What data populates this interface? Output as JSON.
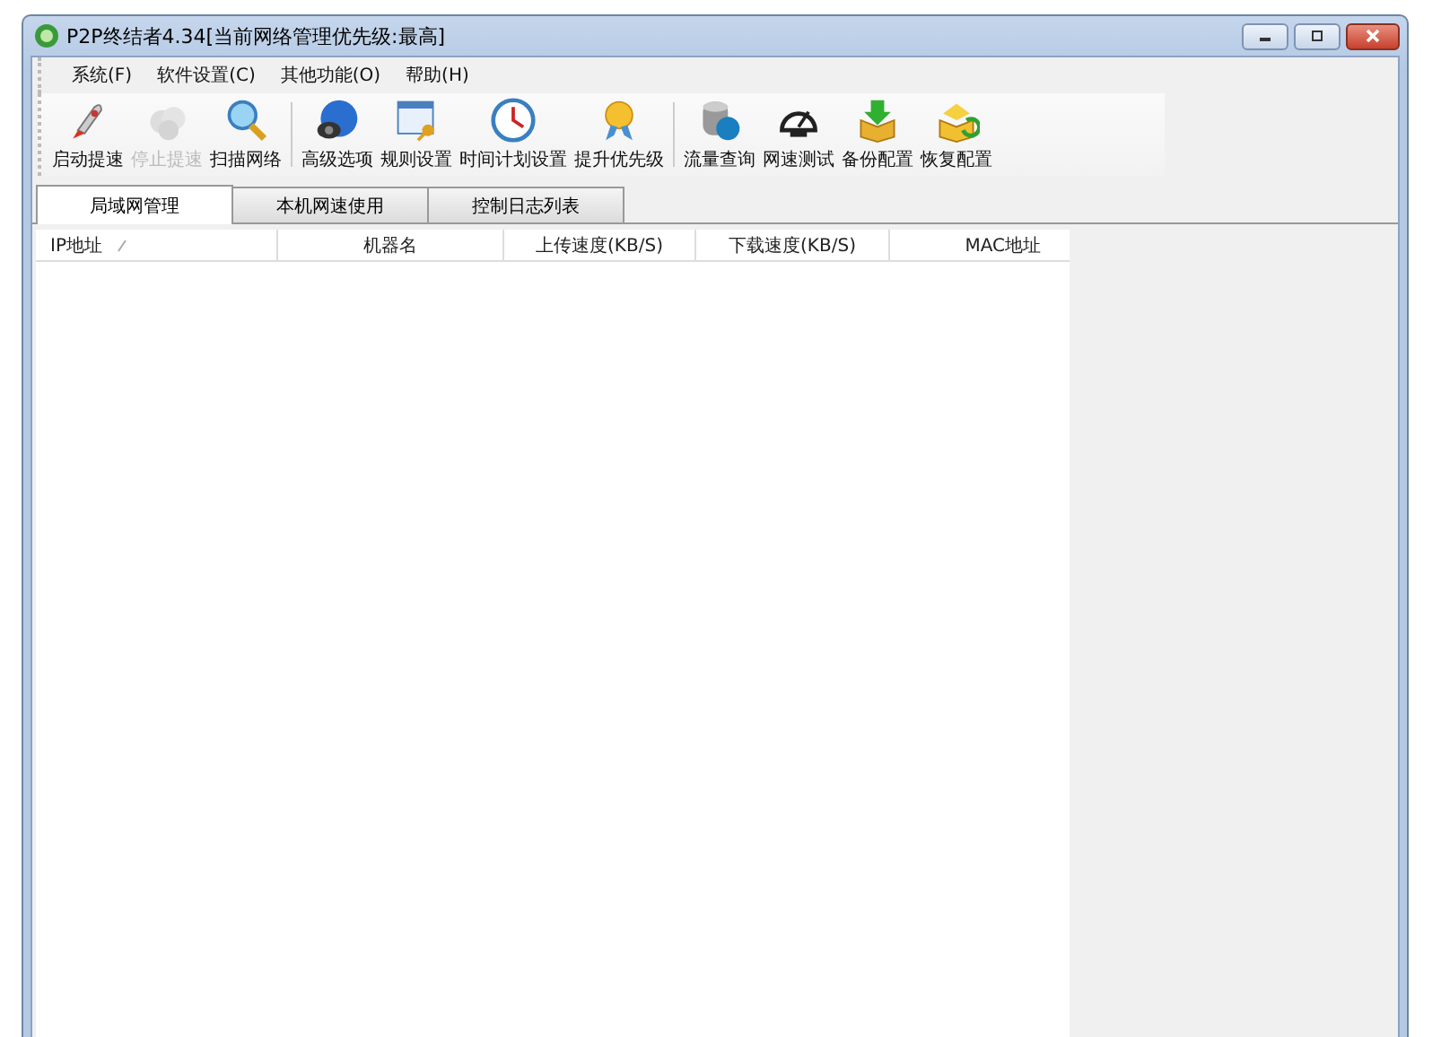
{
  "window": {
    "title": "P2P终结者4.34[当前网络管理优先级:最高]"
  },
  "menu": [
    "系统(F)",
    "软件设置(C)",
    "其他功能(O)",
    "帮助(H)"
  ],
  "toolbar": [
    {
      "items": [
        {
          "label": "启动提速",
          "disabled": false
        },
        {
          "label": "停止提速",
          "disabled": true
        },
        {
          "label": "扫描网络",
          "disabled": false
        }
      ]
    },
    {
      "items": [
        {
          "label": "高级选项",
          "disabled": false
        },
        {
          "label": "规则设置",
          "disabled": false
        },
        {
          "label": "时间计划设置",
          "disabled": false
        },
        {
          "label": "提升优先级",
          "disabled": false
        }
      ]
    },
    {
      "items": [
        {
          "label": "流量查询",
          "disabled": false
        },
        {
          "label": "网速测试",
          "disabled": false
        },
        {
          "label": "备份配置",
          "disabled": false
        },
        {
          "label": "恢复配置",
          "disabled": false
        }
      ]
    }
  ],
  "tabs": [
    {
      "label": "局域网管理",
      "selected": true
    },
    {
      "label": "本机网速使用",
      "selected": false
    },
    {
      "label": "控制日志列表",
      "selected": false
    }
  ],
  "table": {
    "columns": [
      {
        "label": "IP地址",
        "sorted": true
      },
      {
        "label": "机器名",
        "sorted": false
      },
      {
        "label": "上传速度(KB/S)",
        "sorted": false
      },
      {
        "label": "下载速度(KB/S)",
        "sorted": false
      },
      {
        "label": "MAC地址",
        "sorted": false
      }
    ]
  }
}
